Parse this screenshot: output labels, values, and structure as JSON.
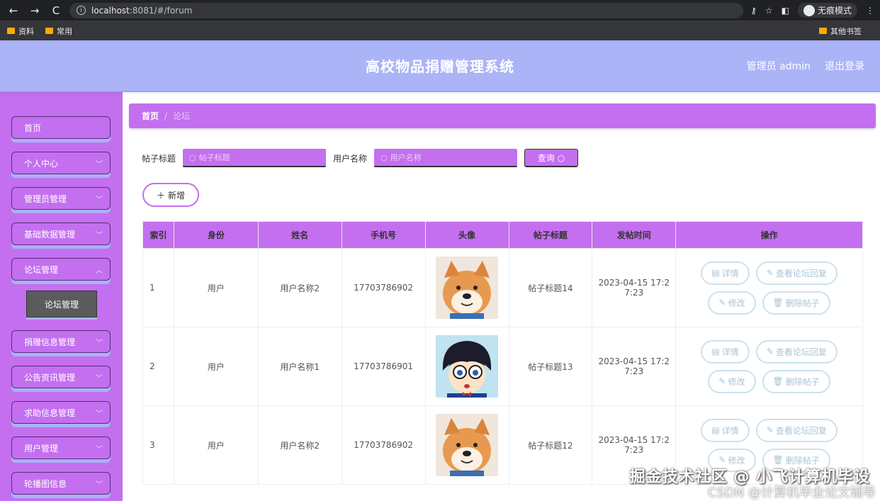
{
  "browser": {
    "url_host": "localhost",
    "url_rest": ":8081/#/forum",
    "incognito_label": "无痕模式",
    "bookmarks": [
      "资料",
      "常用"
    ],
    "bookmarks_right": "其他书签"
  },
  "header": {
    "title": "高校物品捐赠管理系统",
    "user": "管理员 admin",
    "logout": "退出登录"
  },
  "sidebar": {
    "items": [
      {
        "label": "首页",
        "chevron": false
      },
      {
        "label": "个人中心",
        "chevron": true
      },
      {
        "label": "管理员管理",
        "chevron": true
      },
      {
        "label": "基础数据管理",
        "chevron": true
      },
      {
        "label": "论坛管理",
        "chevron": true
      },
      {
        "label": "捐赠信息管理",
        "chevron": true
      },
      {
        "label": "公告资讯管理",
        "chevron": true
      },
      {
        "label": "求助信息管理",
        "chevron": true
      },
      {
        "label": "用户管理",
        "chevron": true
      },
      {
        "label": "轮播图信息",
        "chevron": true
      }
    ],
    "submenu_active": "论坛管理"
  },
  "breadcrumb": {
    "home": "首页",
    "sep": "/",
    "current": "论坛"
  },
  "search": {
    "title_label": "帖子标题",
    "title_placeholder": "帖子标题",
    "user_label": "用户名称",
    "user_placeholder": "用户名称",
    "query_btn": "查询"
  },
  "add_btn": "新增",
  "table": {
    "headers": [
      "索引",
      "身份",
      "姓名",
      "手机号",
      "头像",
      "帖子标题",
      "发帖时间",
      "操作"
    ],
    "rows": [
      {
        "idx": "1",
        "role": "用户",
        "name": "用户名称2",
        "phone": "17703786902",
        "avatar": "shiba",
        "title": "帖子标题14",
        "time1": "2023-04-15 17:2",
        "time2": "7:23"
      },
      {
        "idx": "2",
        "role": "用户",
        "name": "用户名称1",
        "phone": "17703786901",
        "avatar": "conan",
        "title": "帖子标题13",
        "time1": "2023-04-15 17:2",
        "time2": "7:23"
      },
      {
        "idx": "3",
        "role": "用户",
        "name": "用户名称2",
        "phone": "17703786902",
        "avatar": "shiba",
        "title": "帖子标题12",
        "time1": "2023-04-15 17:2",
        "time2": "7:23"
      }
    ],
    "ops": {
      "detail": "详情",
      "reply": "查看论坛回复",
      "edit": "修改",
      "delete": "删除帖子"
    }
  },
  "watermark": {
    "line1": "掘金技术社区 @ 小飞计算机毕设",
    "line2": "CSDN @计算机毕业论文辅导"
  }
}
